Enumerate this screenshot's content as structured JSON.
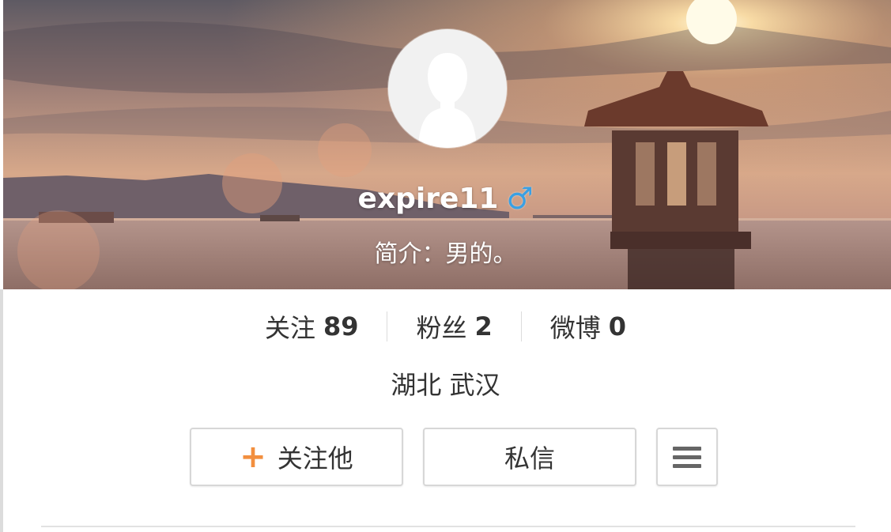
{
  "profile": {
    "username": "expire11",
    "gender_symbol": "♂",
    "intro": "简介：男的。"
  },
  "stats": {
    "following_label": "关注",
    "following_count": "89",
    "followers_label": "粉丝",
    "followers_count": "2",
    "posts_label": "微博",
    "posts_count": "0"
  },
  "location": "湖北 武汉",
  "actions": {
    "follow_icon": "+",
    "follow_label": "关注他",
    "message_label": "私信"
  },
  "colors": {
    "gender_blue": "#3aa0e4",
    "follow_plus": "#f28f3f"
  },
  "icons": {
    "avatar": "default-avatar-icon",
    "more": "hamburger-menu-icon"
  }
}
